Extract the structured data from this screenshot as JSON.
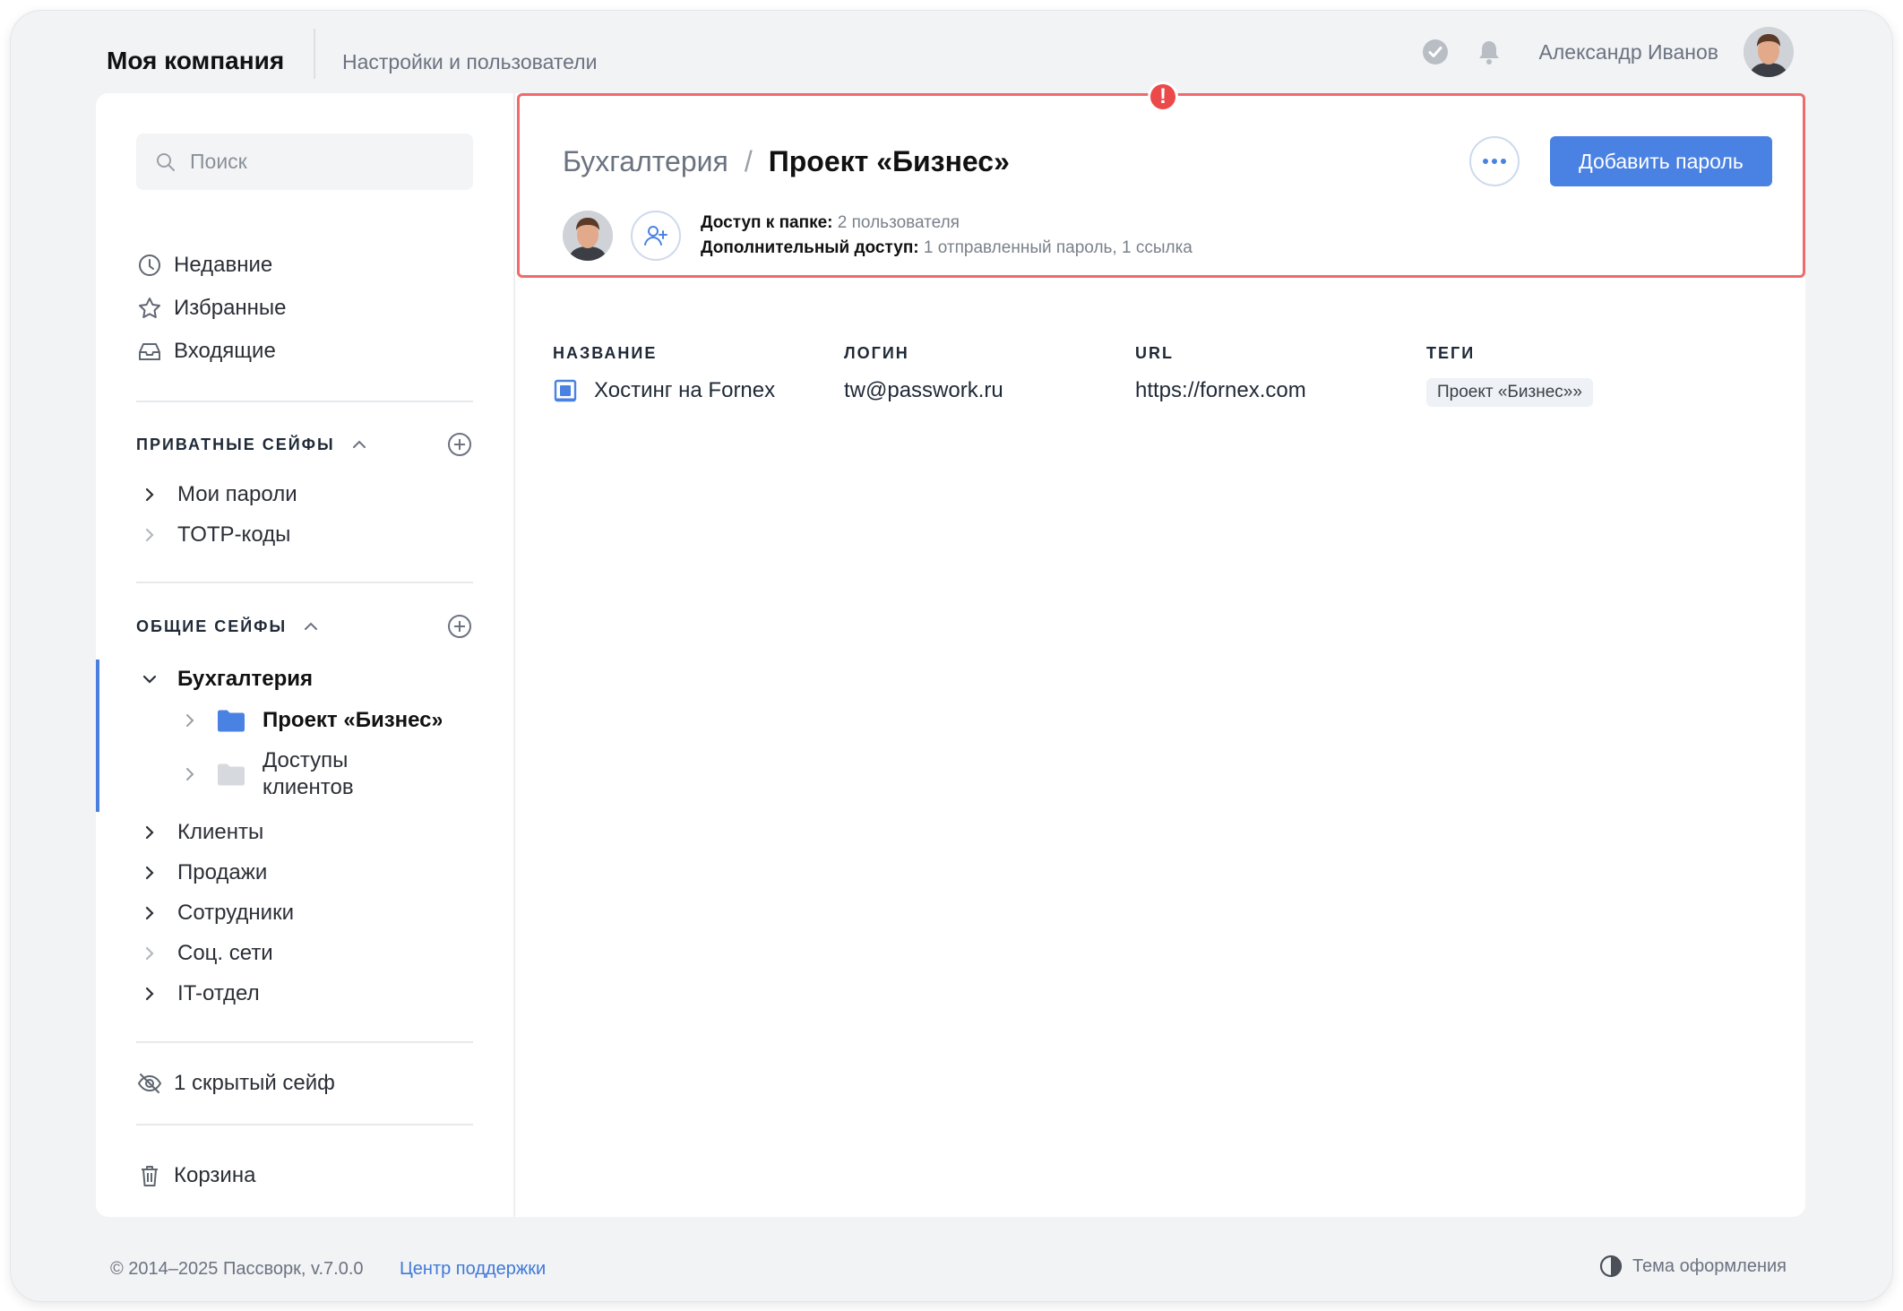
{
  "header": {
    "company": "Моя компания",
    "settings_link": "Настройки и пользователи",
    "user_name": "Александр Иванов"
  },
  "sidebar": {
    "search_placeholder": "Поиск",
    "quick_links": [
      "Недавние",
      "Избранные",
      "Входящие"
    ],
    "private_title": "ПРИВАТНЫЕ СЕЙФЫ",
    "private_items": [
      "Мои пароли",
      "TOTP-коды"
    ],
    "shared_title": "ОБЩИЕ СЕЙФЫ",
    "shared_active": "Бухгалтерия",
    "shared_children": [
      "Проект «Бизнес»",
      "Доступы клиентов"
    ],
    "shared_items": [
      "Клиенты",
      "Продажи",
      "Сотрудники",
      "Соц. сети",
      "IT-отдел"
    ],
    "hidden_vaults": "1 скрытый сейф",
    "trash": "Корзина"
  },
  "content": {
    "breadcrumb_parent": "Бухгалтерия",
    "breadcrumb_separator": "/",
    "breadcrumb_current": "Проект «Бизнес»",
    "add_button": "Добавить пароль",
    "alert_mark": "!",
    "access_label": "Доступ к папке:",
    "access_value": "2 пользователя",
    "extra_label": "Дополнительный доступ:",
    "extra_value": "1 отправленный пароль, 1 ссылка",
    "columns": [
      "НАЗВАНИЕ",
      "ЛОГИН",
      "URL",
      "ТЕГИ"
    ],
    "rows": [
      {
        "name": "Хостинг на Fornex",
        "login": "tw@passwork.ru",
        "url": "https://fornex.com",
        "tag": "Проект «Бизнес»»"
      }
    ]
  },
  "footer": {
    "copyright": "© 2014–2025 Пассворк, v.7.0.0",
    "support": "Центр поддержки",
    "theme": "Тема оформления"
  },
  "colors": {
    "accent": "#4a82e3",
    "alert": "#ec4a4a",
    "highlight_border": "#ef6b6b"
  }
}
